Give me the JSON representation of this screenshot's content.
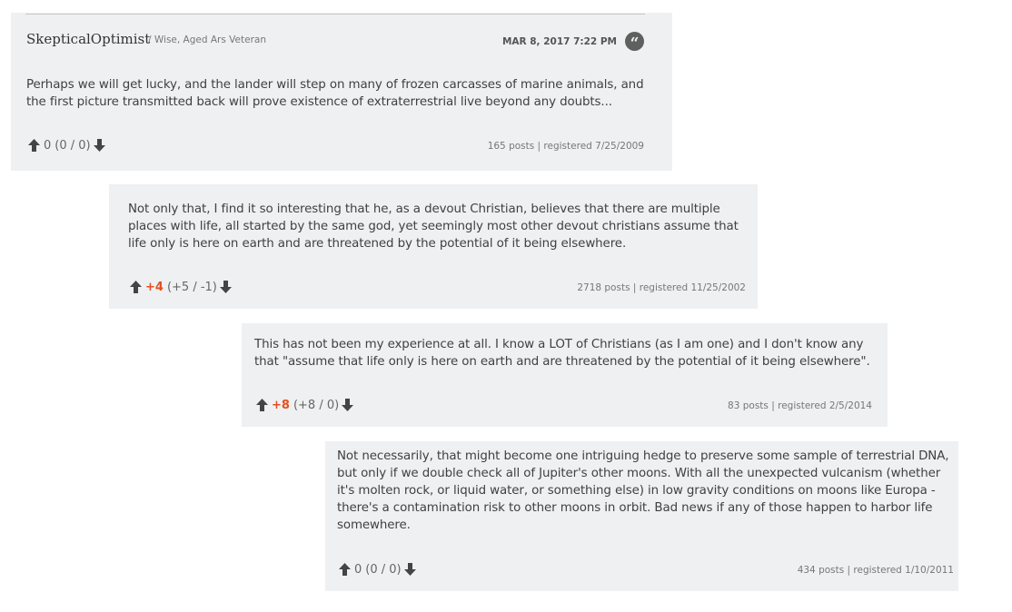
{
  "thread": {
    "first_post": {
      "author": "SkepticalOptimist",
      "rank": "/ Wise, Aged Ars Veteran",
      "date": "MAR 8, 2017 7:22 PM",
      "body": "Perhaps we will get lucky, and the lander will step on many of frozen carcasses of marine animals, and the first picture transmitted back will prove existence of extraterrestrial live beyond any doubts...",
      "score": "0",
      "breakdown": "(0 / 0)",
      "meta": "165 posts | registered 7/25/2009"
    },
    "replies": [
      {
        "body": "Not only that, I find it so interesting that he, as a devout Christian, believes that there are multiple places with life, all started by the same god, yet seemingly most other devout christians assume that life only is here on earth and are threatened by the potential of it being elsewhere.",
        "score": "+4",
        "breakdown": "(+5 / -1)",
        "meta": "2718 posts | registered 11/25/2002"
      },
      {
        "body": "This has not been my experience at all. I know a LOT of Christians (as I am one) and I don't know any that \"assume that life only is here on earth and are threatened by the potential of it being elsewhere\".",
        "score": "+8",
        "breakdown": "(+8 / 0)",
        "meta": "83 posts | registered 2/5/2014"
      },
      {
        "body": "Not necessarily, that might become one intriguing hedge to preserve some sample of terrestrial DNA, but only if we double check all of Jupiter's other moons. With all the unexpected vulcanism (whether it's molten rock, or liquid water, or something else) in low gravity conditions on moons like Europa - there's a contamination risk to other moons in orbit. Bad news if any of those happen to harbor life somewhere.",
        "score": "0",
        "breakdown": "(0 / 0)",
        "meta": "434 posts | registered 1/10/2011"
      }
    ]
  },
  "icons": {
    "upvote": "arrow-up-icon",
    "downvote": "arrow-down-icon",
    "quote": "quote-icon"
  },
  "colors": {
    "post_background": "#eef0f2",
    "positive_score": "#e3501e",
    "arrow": "#444444"
  }
}
